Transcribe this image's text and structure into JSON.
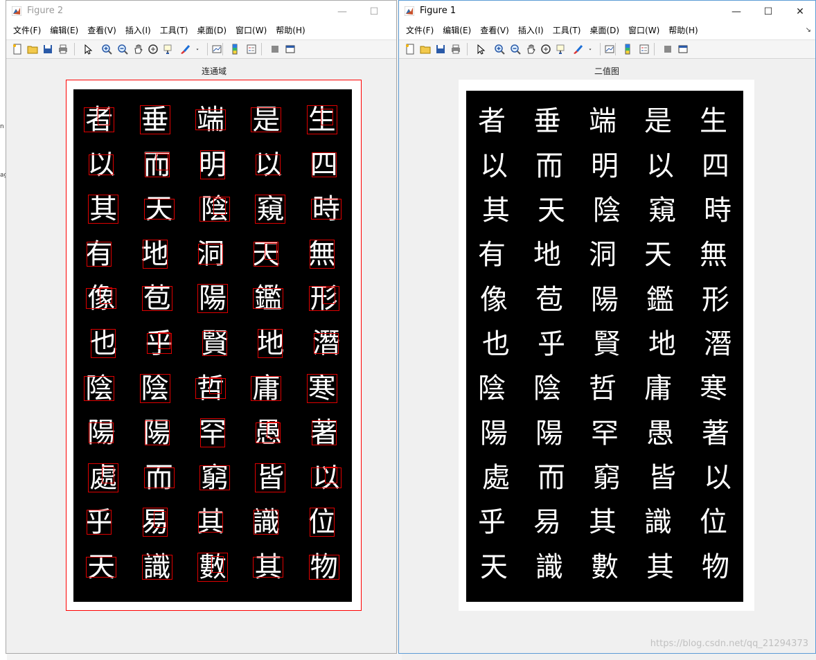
{
  "windows": {
    "fig2": {
      "title": "Figure 2",
      "axes_title": "连通域"
    },
    "fig1": {
      "title": "Figure 1",
      "axes_title": "二值图"
    }
  },
  "window_buttons": {
    "minimize": "—",
    "maximize": "☐",
    "close": "✕"
  },
  "menus": [
    "文件(F)",
    "编辑(E)",
    "查看(V)",
    "插入(I)",
    "工具(T)",
    "桌面(D)",
    "窗口(W)",
    "帮助(H)"
  ],
  "menu_overflow": "↘",
  "toolbar_icons": [
    "new-figure-icon",
    "open-file-icon",
    "save-icon",
    "print-icon",
    "pointer-icon",
    "zoom-in-icon",
    "zoom-out-icon",
    "pan-icon",
    "rotate-3d-icon",
    "data-cursor-icon",
    "brush-icon",
    "dropdown-arrow-icon",
    "link-plot-icon",
    "colorbar-icon",
    "legend-icon",
    "hide-plot-tools-icon",
    "show-plot-tools-icon"
  ],
  "calligraphy_columns": [
    "生四時無形潛寒著以位物",
    "是以窺天鑑地庸愚皆識其",
    "端明陰洞陽賢哲罕窮其數",
    "垂而天地苞乎陰陽而易識",
    "者以其有像也陰陽處乎天"
  ],
  "desktop": {
    "left_fragments": [
      "n",
      "ag"
    ]
  },
  "watermark": "https://blog.csdn.net/qq_21294373",
  "colors": {
    "bbox": "#e00000",
    "axes_border": "#ff0000",
    "background": "#000000",
    "foreground": "#ffffff"
  }
}
